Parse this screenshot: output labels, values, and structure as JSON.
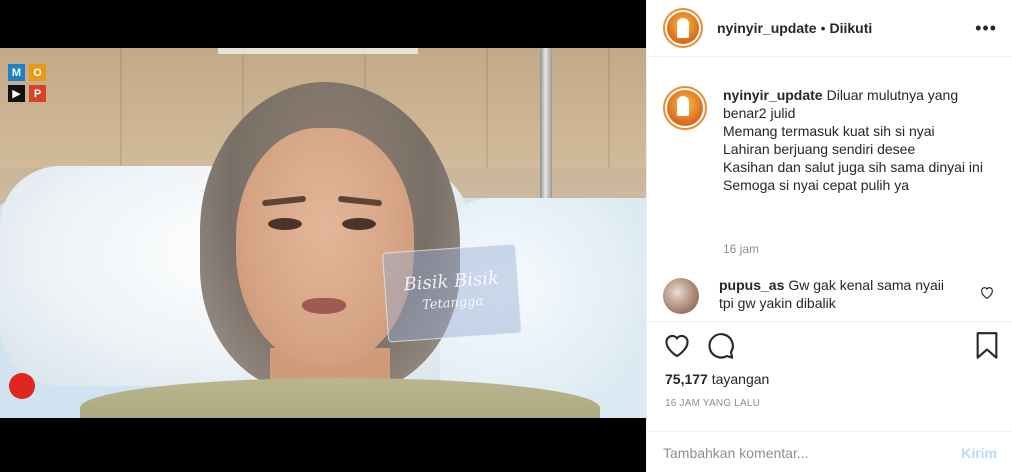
{
  "media": {
    "logo_letters": [
      "M",
      "O",
      "▶",
      "P"
    ],
    "watermark_line1": "Bisik Bisik",
    "watermark_line2": "Tetangga"
  },
  "header": {
    "username": "nyinyir_update",
    "separator": "•",
    "follow_status": "Diikuti",
    "more_icon": "more-horizontal-icon"
  },
  "caption": {
    "username": "nyinyir_update",
    "lines": [
      "Diluar mulutnya yang benar2 julid",
      "Memang termasuk kuat sih si nyai",
      "Lahiran berjuang sendiri desee",
      "Kasihan dan salut juga sih sama dinyai ini",
      "Semoga si nyai cepat pulih ya"
    ],
    "time": "16 jam"
  },
  "comments": [
    {
      "username": "pupus_as",
      "text": "Gw gak kenal sama nyaii tpi gw yakin dibalik"
    }
  ],
  "actions": {
    "like_icon": "heart-outline-icon",
    "comment_icon": "comment-bubble-icon",
    "save_icon": "bookmark-icon",
    "views_count": "75,177",
    "views_label": "tayangan",
    "time_ago": "16 JAM YANG LALU"
  },
  "add_comment": {
    "placeholder": "Tambahkan komentar...",
    "post_label": "Kirim"
  },
  "colors": {
    "avatar_ring": "#f28b2e",
    "post_button_disabled": "#b3dbff",
    "muted_text": "#8e8e8e",
    "record_dot": "#e0271f"
  }
}
